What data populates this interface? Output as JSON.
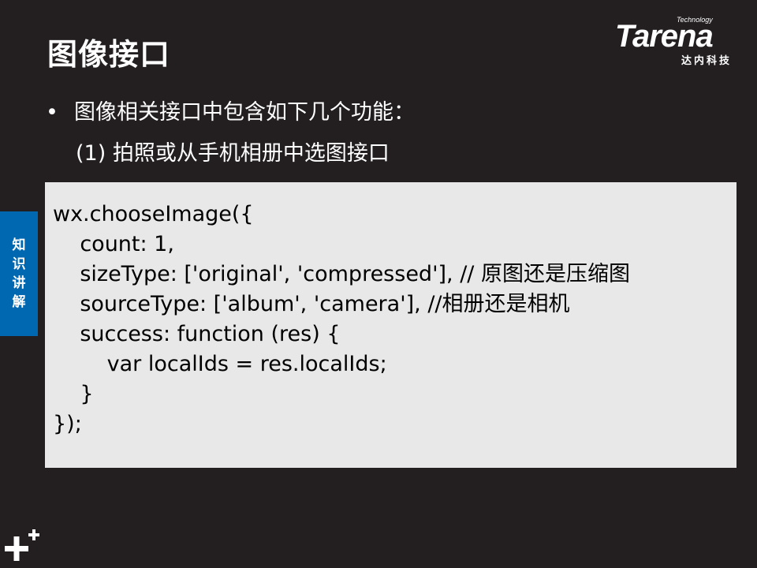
{
  "slide": {
    "title": "图像接口",
    "bullet": "图像相关接口中包含如下几个功能：",
    "bullet_symbol": "•",
    "sub_item": "(1) 拍照或从手机相册中选图接口"
  },
  "logo": {
    "tech": "Technology",
    "brand": "Tarena",
    "cn": "达内科技"
  },
  "side_tab": {
    "chars": [
      "知",
      "识",
      "讲",
      "解"
    ]
  },
  "code": {
    "lines": [
      "wx.chooseImage({",
      "    count: 1,",
      "    sizeType: ['original', 'compressed'], // 原图还是压缩图",
      "    sourceType: ['album', 'camera'], //相册还是相机",
      "    success: function (res) {",
      "        var localIds = res.localIds;",
      "    }",
      "});"
    ]
  },
  "colors": {
    "background": "#231f20",
    "code_background": "#e8e8e8",
    "side_tab": "#0067b1",
    "text": "#ffffff"
  },
  "icons": {
    "corner": "plus-plus-icon"
  }
}
